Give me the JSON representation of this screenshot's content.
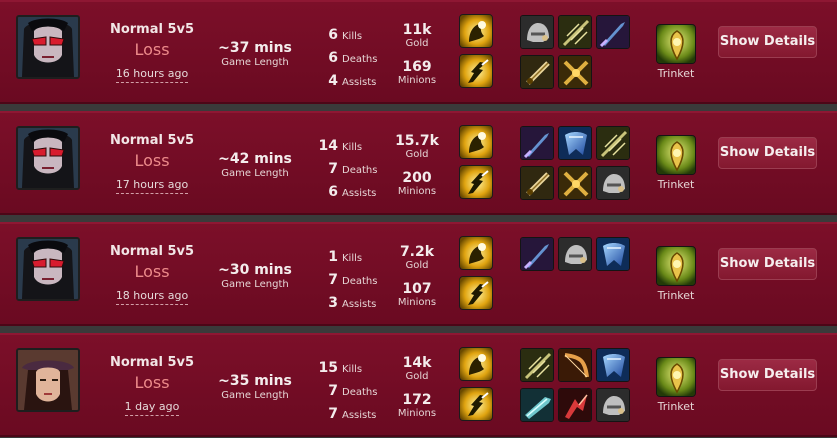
{
  "matches": [
    {
      "champion_icon": "vayne-portrait",
      "queue": "Normal 5v5",
      "result": "Loss",
      "time_ago": "16 hours ago",
      "length": "~37 mins",
      "length_label": "Game Length",
      "kills": "6",
      "kills_label": "Kills",
      "deaths": "6",
      "deaths_label": "Deaths",
      "assists": "4",
      "assists_label": "Assists",
      "gold": "11k",
      "gold_label": "Gold",
      "minions": "169",
      "minions_label": "Minions",
      "spells": [
        "heal-icon",
        "flash-icon"
      ],
      "items": [
        "helmet-icon",
        "bow-icon",
        "blade-icon",
        "bloodthirster-icon",
        "crossed-swords-icon"
      ],
      "trinket_icon": "warding-totem-icon",
      "trinket_label": "Trinket",
      "button": "Show Details"
    },
    {
      "champion_icon": "vayne-portrait",
      "queue": "Normal 5v5",
      "result": "Loss",
      "time_ago": "17 hours ago",
      "length": "~42 mins",
      "length_label": "Game Length",
      "kills": "14",
      "kills_label": "Kills",
      "deaths": "7",
      "deaths_label": "Deaths",
      "assists": "6",
      "assists_label": "Assists",
      "gold": "15.7k",
      "gold_label": "Gold",
      "minions": "200",
      "minions_label": "Minions",
      "spells": [
        "heal-icon",
        "flash-icon"
      ],
      "items": [
        "blade-icon",
        "cape-icon",
        "bow-icon",
        "bloodthirster-icon",
        "crossed-swords-icon",
        "helmet-icon"
      ],
      "trinket_icon": "warding-totem-icon",
      "trinket_label": "Trinket",
      "button": "Show Details"
    },
    {
      "champion_icon": "vayne-portrait",
      "queue": "Normal 5v5",
      "result": "Loss",
      "time_ago": "18 hours ago",
      "length": "~30 mins",
      "length_label": "Game Length",
      "kills": "1",
      "kills_label": "Kills",
      "deaths": "7",
      "deaths_label": "Deaths",
      "assists": "3",
      "assists_label": "Assists",
      "gold": "7.2k",
      "gold_label": "Gold",
      "minions": "107",
      "minions_label": "Minions",
      "spells": [
        "heal-icon",
        "flash-icon"
      ],
      "items": [
        "blade-icon",
        "helmet-icon",
        "cape-icon"
      ],
      "trinket_icon": "warding-totem-icon",
      "trinket_label": "Trinket",
      "button": "Show Details"
    },
    {
      "champion_icon": "caitlyn-portrait",
      "queue": "Normal 5v5",
      "result": "Loss",
      "time_ago": "1 day ago",
      "length": "~35 mins",
      "length_label": "Game Length",
      "kills": "15",
      "kills_label": "Kills",
      "deaths": "7",
      "deaths_label": "Deaths",
      "assists": "7",
      "assists_label": "Assists",
      "gold": "14k",
      "gold_label": "Gold",
      "minions": "172",
      "minions_label": "Minions",
      "spells": [
        "heal-icon",
        "flash-icon"
      ],
      "items": [
        "bow-icon",
        "longbow-icon",
        "cape-icon",
        "sword-icon",
        "claw-icon",
        "helmet-icon"
      ],
      "trinket_icon": "warding-totem-icon",
      "trinket_label": "Trinket",
      "button": "Show Details"
    }
  ]
}
